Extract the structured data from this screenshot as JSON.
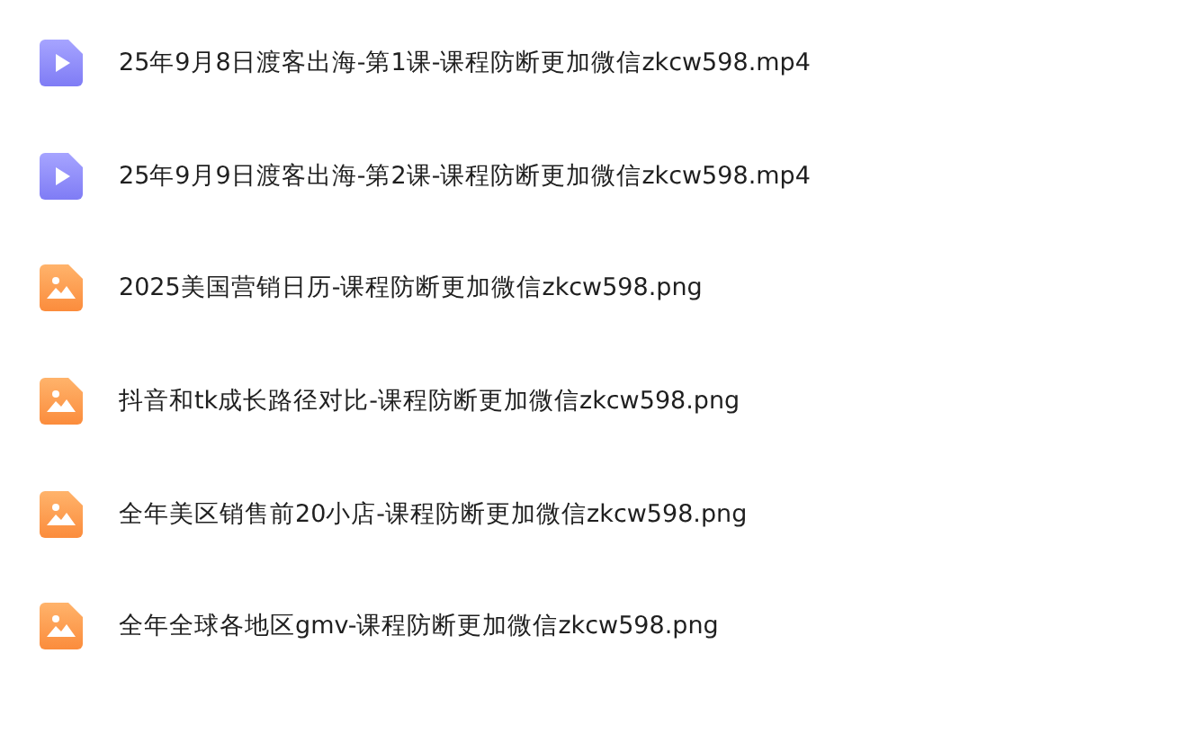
{
  "files": [
    {
      "kind": "video",
      "name": "25年9月8日渡客出海-第1课-课程防断更加微信zkcw598.mp4"
    },
    {
      "kind": "video",
      "name": "25年9月9日渡客出海-第2课-课程防断更加微信zkcw598.mp4"
    },
    {
      "kind": "image",
      "name": "2025美国营销日历-课程防断更加微信zkcw598.png"
    },
    {
      "kind": "image",
      "name": "抖音和tk成长路径对比-课程防断更加微信zkcw598.png"
    },
    {
      "kind": "image",
      "name": "全年美区销售前20小店-课程防断更加微信zkcw598.png"
    },
    {
      "kind": "image",
      "name": "全年全球各地区gmv-课程防断更加微信zkcw598.png"
    }
  ]
}
